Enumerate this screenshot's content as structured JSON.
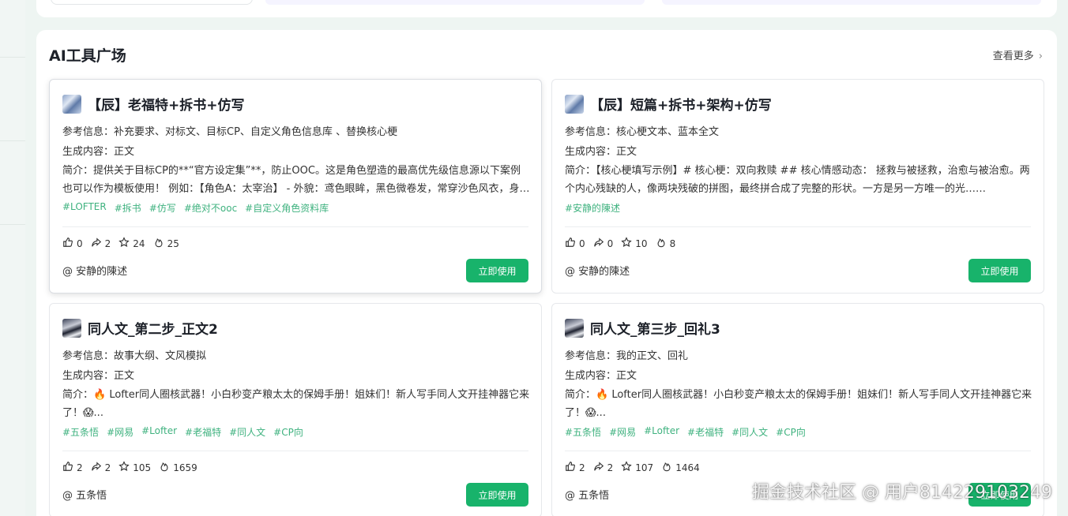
{
  "section": {
    "title": "AI工具广场",
    "see_more": "查看更多"
  },
  "labels": {
    "ref": "参考信息：",
    "gen": "生成内容：",
    "intro": "简介：",
    "use": "立即使用",
    "at": "@ "
  },
  "cards": [
    {
      "title": "【辰】老福特+拆书+仿写",
      "ref": "补充要求、对标文、目标CP、自定义角色信息库 、替换核心梗",
      "gen": "正文",
      "desc": "提供关于目标CP的**“官方设定集”**，防止OOC。这是角色塑造的最高优先级信息源以下案例也可以作为模板使用！ 例如：【角色A：太宰治】 - 外貌：鸢色眼眸，黑色微卷发，常穿沙色风衣，身上缠绕着绷带……",
      "tags": [
        "#LOFTER",
        "#拆书",
        "#仿写",
        "#绝对不ooc",
        "#自定义角色资料库"
      ],
      "likes": "0",
      "shares": "2",
      "stars": "24",
      "uses": "25",
      "author": "安静的陳述"
    },
    {
      "title": "【辰】短篇+拆书+架构+仿写",
      "ref": "核心梗文本、蓝本全文",
      "gen": "正文",
      "desc": "【核心梗填写示例】# 核心梗：双向救赎 ## 核心情感动态： 拯救与被拯救，治愈与被治愈。两个内心残缺的人，像两块残破的拼图，最终拼合成了完整的形状。一方是另一方唯一的光……",
      "tags": [
        "#安静的陳述"
      ],
      "likes": "0",
      "shares": "0",
      "stars": "10",
      "uses": "8",
      "author": "安静的陳述"
    },
    {
      "title": "同人文_第二步_正文2",
      "ref": "故事大纲、文风模拟",
      "gen": "正文",
      "desc": "🔥 Lofter同人圈核武器！小白秒变产粮太太的保姆手册！姐妹们！新人写手同人文开挂神器它来了！😱...",
      "tags": [
        "#五条悟",
        "#网易",
        "#Lofter",
        "#老福特",
        "#同人文",
        "#CP向"
      ],
      "likes": "2",
      "shares": "2",
      "stars": "105",
      "uses": "1659",
      "author": "五条悟"
    },
    {
      "title": "同人文_第三步_回礼3",
      "ref": "我的正文、回礼",
      "gen": "正文",
      "desc": "🔥 Lofter同人圈核武器！小白秒变产粮太太的保姆手册！姐妹们！新人写手同人文开挂神器它来了！😱...",
      "tags": [
        "#五条悟",
        "#网易",
        "#Lofter",
        "#老福特",
        "#同人文",
        "#CP向"
      ],
      "likes": "2",
      "shares": "2",
      "stars": "107",
      "uses": "1464",
      "author": "五条悟"
    }
  ],
  "watermark": "掘金技术社区 @ 用户8142291032​49",
  "colors": {
    "accent": "#18b36b",
    "tag": "#3fb27f",
    "bg": "#eef5f2"
  }
}
